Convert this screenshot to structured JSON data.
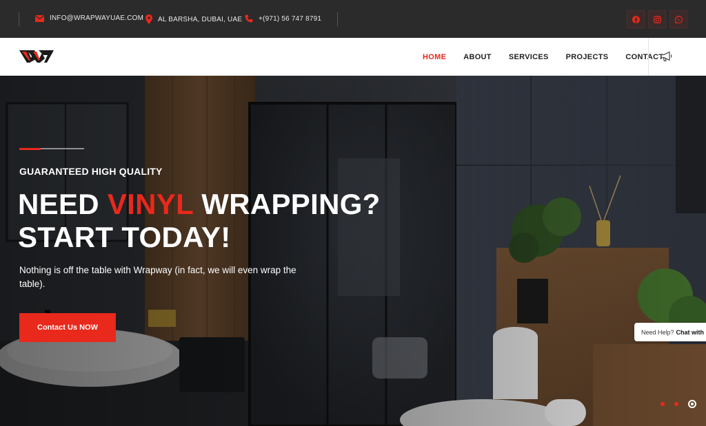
{
  "topbar": {
    "email": "INFO@WRAPWAYUAE.COM",
    "address": "AL BARSHA, DUBAI, UAE",
    "phone": "+(971) 56 747 8791",
    "socials": [
      "facebook-icon",
      "instagram-icon",
      "whatsapp-icon"
    ]
  },
  "nav": {
    "items": [
      {
        "label": "HOME",
        "active": true
      },
      {
        "label": "ABOUT",
        "active": false
      },
      {
        "label": "SERVICES",
        "active": false
      },
      {
        "label": "PROJECTS",
        "active": false
      },
      {
        "label": "CONTACT",
        "active": false
      }
    ]
  },
  "hero": {
    "kicker": "GUARANTEED HIGH QUALITY",
    "headline_part1": "NEED ",
    "headline_red": "VINYL",
    "headline_part2": " WRAPPING?",
    "headline_line2": "START TODAY!",
    "description": "Nothing is off the table with Wrapway (in fact, we will even wrap the table).",
    "cta_label": "Contact Us NOW"
  },
  "chat": {
    "prefix": "Need Help?",
    "bold": "Chat with us"
  },
  "colors": {
    "accent": "#e8291c",
    "topbar_bg": "#2b2b2b",
    "nav_bg": "#ffffff"
  }
}
